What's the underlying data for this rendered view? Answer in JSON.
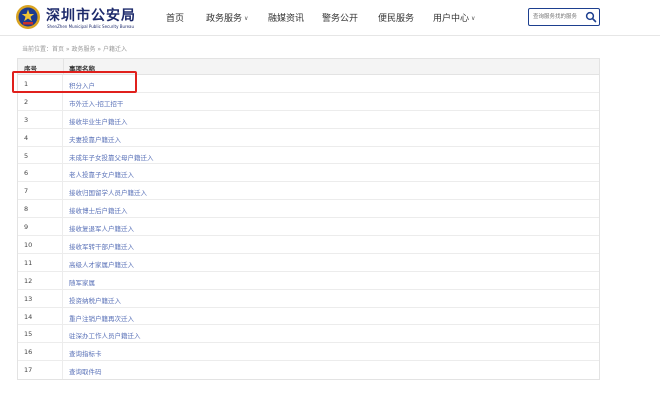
{
  "header": {
    "logo_title": "深圳市公安局",
    "logo_subtitle": "ShenZhen Municipal Public Security Bureau",
    "nav": [
      {
        "label": "首页",
        "dropdown": false
      },
      {
        "label": "政务服务",
        "dropdown": true
      },
      {
        "label": "融媒资讯",
        "dropdown": false
      },
      {
        "label": "警务公开",
        "dropdown": false
      },
      {
        "label": "便民服务",
        "dropdown": false
      },
      {
        "label": "用户中心",
        "dropdown": true
      }
    ],
    "search_placeholder": "查询服务找的服务"
  },
  "breadcrumb": "当前位置：首页 » 政务服务 » 户籍迁入",
  "table": {
    "columns": [
      "序号",
      "事项名称"
    ],
    "rows": [
      {
        "num": "1",
        "name": "积分入户"
      },
      {
        "num": "2",
        "name": "市外迁入-招工招干"
      },
      {
        "num": "3",
        "name": "接收毕业生户籍迁入"
      },
      {
        "num": "4",
        "name": "夫妻投靠户籍迁入"
      },
      {
        "num": "5",
        "name": "未成年子女投靠父母户籍迁入"
      },
      {
        "num": "6",
        "name": "老人投靠子女户籍迁入"
      },
      {
        "num": "7",
        "name": "接收归国留学人员户籍迁入"
      },
      {
        "num": "8",
        "name": "接收博士后户籍迁入"
      },
      {
        "num": "9",
        "name": "接收复退军人户籍迁入"
      },
      {
        "num": "10",
        "name": "接收军转干部户籍迁入"
      },
      {
        "num": "11",
        "name": "高级人才家属户籍迁入"
      },
      {
        "num": "12",
        "name": "随军家属"
      },
      {
        "num": "13",
        "name": "投资纳税户籍迁入"
      },
      {
        "num": "14",
        "name": "重户注销户籍再次迁入"
      },
      {
        "num": "15",
        "name": "驻深办工作人员户籍迁入"
      },
      {
        "num": "16",
        "name": "查询指标卡"
      },
      {
        "num": "17",
        "name": "查询取件码"
      }
    ]
  },
  "colors": {
    "brand": "#1d2a6b",
    "link": "#5a72b8",
    "highlight": "#e0201c"
  }
}
